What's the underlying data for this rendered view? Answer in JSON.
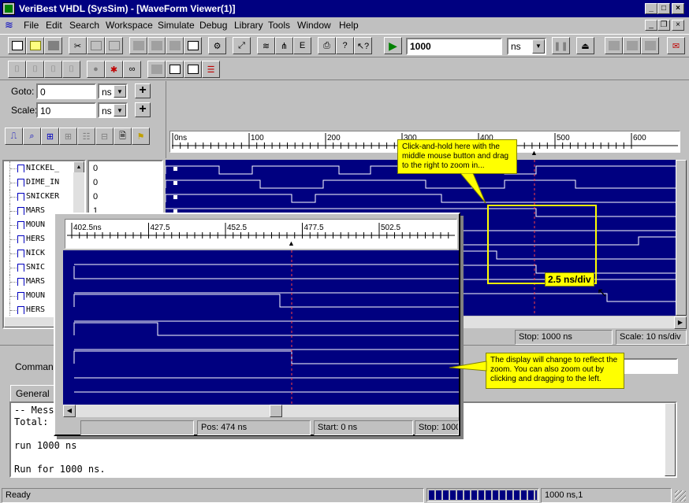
{
  "window": {
    "title": "VeriBest VHDL (SysSim) - [WaveForm Viewer(1)]"
  },
  "menu": [
    "File",
    "Edit",
    "Search",
    "Workspace",
    "Simulate",
    "Debug",
    "Library",
    "Tools",
    "Window",
    "Help"
  ],
  "toolbar": {
    "time_value": "1000",
    "time_unit": "ns"
  },
  "controls": {
    "goto_label": "Goto:",
    "goto_value": "0",
    "goto_unit": "ns",
    "scale_label": "Scale:",
    "scale_value": "10",
    "scale_unit": "ns"
  },
  "ruler": {
    "labels": [
      "0ns",
      "100",
      "200",
      "300",
      "400",
      "500",
      "600"
    ]
  },
  "signals": [
    "NICKEL_",
    "DIME_IN",
    "SNICKER",
    "MARS",
    "MOUN",
    "HERS",
    "NICK",
    "SNIC",
    "MARS",
    "MOUN",
    "HERS"
  ],
  "values": [
    "0",
    "0",
    "0",
    "1"
  ],
  "zoom_ruler": {
    "labels": [
      "402.5ns",
      "427.5",
      "452.5",
      "477.5",
      "502.5",
      "5"
    ]
  },
  "callouts": {
    "drag": "Click-and-hold here with the middle mouse button and drag to the right to zoom in...",
    "scale": "2.5 ns/div",
    "display": "The display will change to reflect the zoom.  You can also zoom out by clicking and dragging to the left."
  },
  "wave_status": {
    "stop": "Stop: 1000 ns",
    "scale": "Scale: 10 ns/div"
  },
  "zoom_status": {
    "pos": "Pos: 474 ns",
    "start": "Start: 0 ns",
    "stop": "Stop: 1000"
  },
  "command": {
    "label": "Command",
    "value": ""
  },
  "tabs": {
    "general": "General"
  },
  "console": {
    "lines": [
      "-- Mess",
      "Total: ",
      "",
      "run 1000 ns",
      "",
      "Run for 1000 ns."
    ]
  },
  "statusbar": {
    "ready": "Ready",
    "progress_fraction": 1.0,
    "time": "1000 ns,1"
  }
}
